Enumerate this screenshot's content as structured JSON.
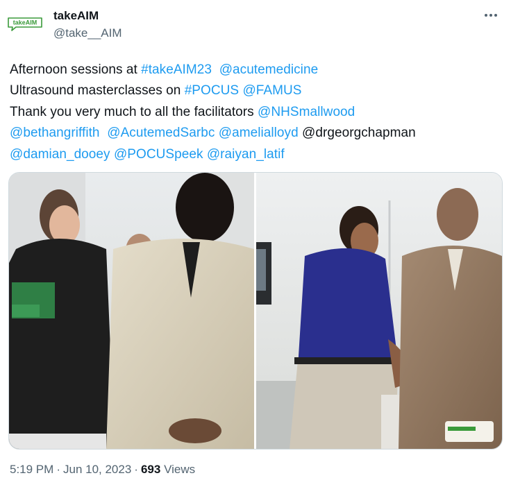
{
  "author": {
    "display_name": "takeAIM",
    "handle": "@take__AIM",
    "avatar_icon": "takeaim-logo",
    "avatar_text": "takeAIM",
    "brand_color": "#3a9a3a"
  },
  "more_icon": "ellipsis-icon",
  "tweet": {
    "lines": [
      [
        {
          "text": "Afternoon sessions at ",
          "type": "text"
        },
        {
          "text": "#takeAIM23",
          "type": "hashtag"
        },
        {
          "text": "  ",
          "type": "text"
        },
        {
          "text": "@acutemedicine",
          "type": "mention"
        }
      ],
      [
        {
          "text": "Ultrasound masterclasses on ",
          "type": "text"
        },
        {
          "text": "#POCUS",
          "type": "hashtag"
        },
        {
          "text": " ",
          "type": "text"
        },
        {
          "text": "@FAMUS",
          "type": "mention"
        }
      ],
      [
        {
          "text": "Thank you very much to all the facilitators ",
          "type": "text"
        },
        {
          "text": "@NHSmallwood",
          "type": "mention"
        }
      ],
      [
        {
          "text": "@bethangriffith",
          "type": "mention"
        },
        {
          "text": "  ",
          "type": "text"
        },
        {
          "text": "@AcutemedSarbc",
          "type": "mention"
        },
        {
          "text": " ",
          "type": "text"
        },
        {
          "text": "@amelialloyd",
          "type": "mention"
        },
        {
          "text": " @drgeorgchapman",
          "type": "text"
        }
      ],
      [
        {
          "text": "@damian_dooey",
          "type": "mention"
        },
        {
          "text": " ",
          "type": "text"
        },
        {
          "text": "@POCUSpeek",
          "type": "mention"
        },
        {
          "text": " ",
          "type": "text"
        },
        {
          "text": "@raiyan_latif",
          "type": "mention"
        }
      ]
    ]
  },
  "media": {
    "photos": [
      {
        "id": "photo-left",
        "depicts": "ultrasound-training-scene-1"
      },
      {
        "id": "photo-right",
        "depicts": "ultrasound-training-scene-2"
      }
    ]
  },
  "meta": {
    "time": "5:19 PM",
    "separator": "·",
    "date": "Jun 10, 2023",
    "views_count": "693",
    "views_label": "Views"
  },
  "colors": {
    "link": "#1d9bf0",
    "text": "#0f1419",
    "secondary": "#536471",
    "border": "#cfd9de"
  }
}
